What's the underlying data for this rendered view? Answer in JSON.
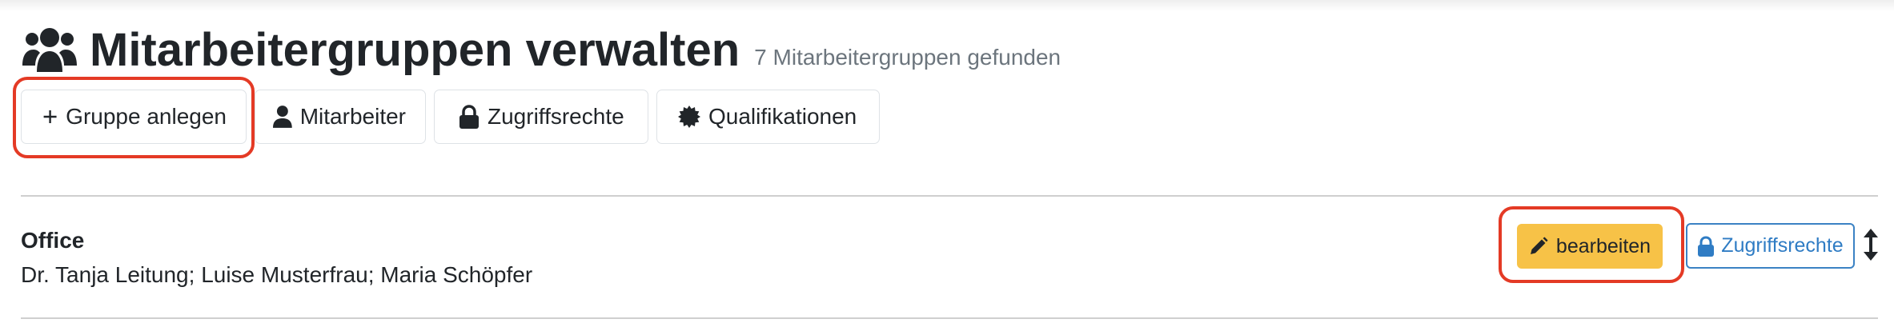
{
  "header": {
    "title": "Mitarbeitergruppen verwalten",
    "subtitle": "7 Mitarbeitergruppen gefunden",
    "icon": "users-icon"
  },
  "toolbar": {
    "add_group": "Gruppe anlegen",
    "employees": "Mitarbeiter",
    "access_rights": "Zugriffsrechte",
    "qualifications": "Qualifikationen"
  },
  "groups": [
    {
      "name": "Office",
      "members": "Dr. Tanja Leitung; Luise Musterfrau; Maria Schöpfer",
      "edit_label": "bearbeiten",
      "rights_label": "Zugriffsrechte"
    }
  ],
  "colors": {
    "edit_button": "#f7c247",
    "rights_button": "#2f7cc4",
    "highlight": "#e43a25",
    "subtitle": "#6c757d"
  }
}
